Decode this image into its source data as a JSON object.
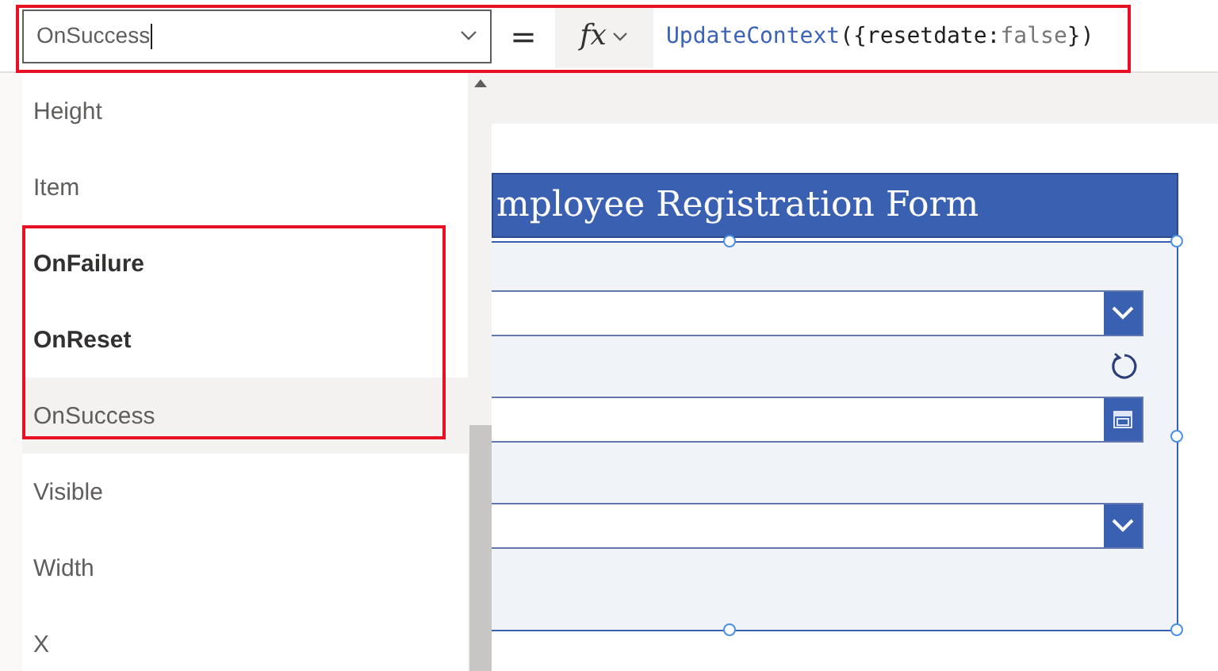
{
  "property_selector": {
    "value": "OnSuccess"
  },
  "equals_sign": "=",
  "fx_button": {
    "label": "fx"
  },
  "formula": [
    {
      "kind": "function",
      "text": "UpdateContext"
    },
    {
      "kind": "plain",
      "text": "({resetdate:"
    },
    {
      "kind": "keyword",
      "text": "false"
    },
    {
      "kind": "plain",
      "text": "})"
    }
  ],
  "property_list": [
    {
      "label": "Height",
      "modified": false,
      "selected": false
    },
    {
      "label": "Item",
      "modified": false,
      "selected": false
    },
    {
      "label": "OnFailure",
      "modified": true,
      "selected": false
    },
    {
      "label": "OnReset",
      "modified": true,
      "selected": false
    },
    {
      "label": "OnSuccess",
      "modified": false,
      "selected": true
    },
    {
      "label": "Visible",
      "modified": false,
      "selected": false
    },
    {
      "label": "Width",
      "modified": false,
      "selected": false
    },
    {
      "label": "X",
      "modified": false,
      "selected": false
    }
  ],
  "form": {
    "title": "mployee Registration Form",
    "fields": [
      {
        "kind": "dropdown"
      },
      {
        "kind": "date"
      },
      {
        "kind": "dropdown"
      }
    ]
  }
}
